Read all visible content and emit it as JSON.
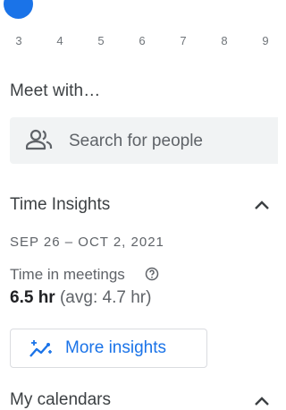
{
  "mini_calendar": {
    "days": [
      "3",
      "4",
      "5",
      "6",
      "7",
      "8",
      "9"
    ]
  },
  "meet_with": {
    "title": "Meet with…",
    "search_placeholder": "Search for people"
  },
  "time_insights": {
    "title": "Time Insights",
    "date_range": "SEP 26 – OCT 2, 2021",
    "label": "Time in meetings",
    "hours": "6.5 hr",
    "average": "(avg: 4.7 hr)",
    "more_button": "More insights"
  },
  "my_calendars": {
    "title": "My calendars"
  },
  "colors": {
    "accent": "#1a73e8",
    "text": "#3c4043",
    "muted": "#5f6368",
    "search_bg": "#f1f3f4"
  },
  "icons": {
    "people": "people-icon",
    "help": "help-icon",
    "sparkle": "insights-sparkle-icon",
    "chevron": "chevron-up-icon"
  }
}
